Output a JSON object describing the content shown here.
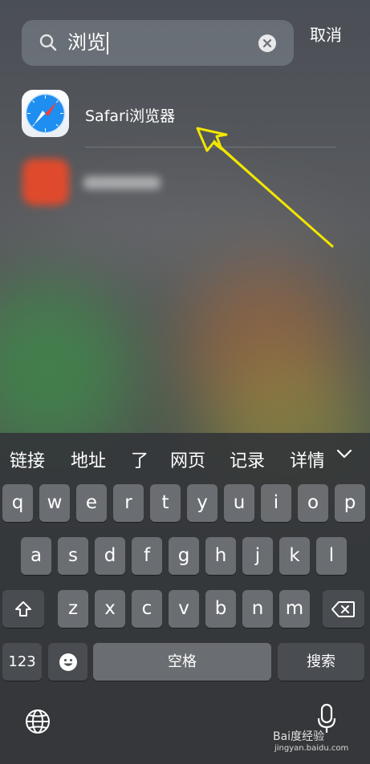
{
  "search": {
    "query": "浏览",
    "cancel_label": "取消"
  },
  "results": [
    {
      "label": "Safari浏览器",
      "icon": "safari-compass-icon"
    }
  ],
  "suggestions": [
    "链接",
    "地址",
    "了",
    "网页",
    "记录",
    "详情"
  ],
  "keyboard": {
    "row1": [
      "q",
      "w",
      "e",
      "r",
      "t",
      "y",
      "u",
      "i",
      "o",
      "p"
    ],
    "row2": [
      "a",
      "s",
      "d",
      "f",
      "g",
      "h",
      "j",
      "k",
      "l"
    ],
    "row3": [
      "z",
      "x",
      "c",
      "v",
      "b",
      "n",
      "m"
    ],
    "numbers_label": "123",
    "space_label": "空格",
    "search_label": "搜索"
  },
  "watermark": {
    "brand": "Bai度经验",
    "url": "jingyan.baidu.com"
  },
  "colors": {
    "arrow": "#f2e600",
    "safari_blue": "#1f8ef1"
  }
}
